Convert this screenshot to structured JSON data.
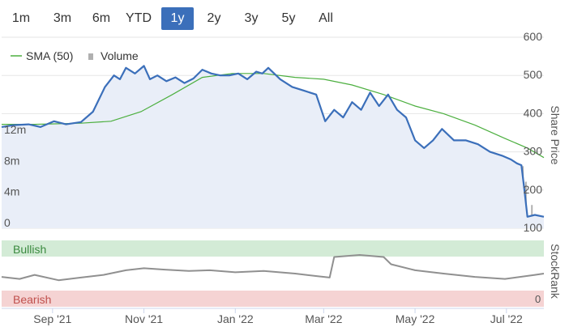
{
  "range_selector": {
    "buttons": [
      "1m",
      "3m",
      "6m",
      "YTD",
      "1y",
      "2y",
      "3y",
      "5y",
      "All"
    ],
    "active": "1y"
  },
  "colors": {
    "price": "#3b6fba",
    "sma": "#4caf3f",
    "volume": "#b0b0b0",
    "stockrank": "#909090",
    "bullish_band": "#d3ebd6",
    "bearish_band": "#f5d3d3"
  },
  "chart_data": [
    {
      "type": "line",
      "panel": "price",
      "legend": [
        "SMA (50)",
        "Volume"
      ],
      "y_axis": {
        "title": "Share Price",
        "ticks": [
          100,
          200,
          300,
          400,
          500,
          600
        ],
        "range": [
          100,
          600
        ]
      },
      "volume_axis": {
        "ticks": [
          "0",
          "4m",
          "8m",
          "12m"
        ],
        "range_millions": [
          0,
          12
        ]
      },
      "x_axis": {
        "ticks": [
          "Sep '21",
          "Nov '21",
          "Jan '22",
          "Mar '22",
          "May '22",
          "Jul '22"
        ]
      },
      "series": [
        {
          "name": "",
          "x": [
            "2021-07-29",
            "2021-08-06",
            "2021-08-16",
            "2021-08-24",
            "2021-09-02",
            "2021-09-10",
            "2021-09-20",
            "2021-09-28",
            "2021-10-06",
            "2021-10-12",
            "2021-10-16",
            "2021-10-20",
            "2021-10-26",
            "2021-11-01",
            "2021-11-05",
            "2021-11-10",
            "2021-11-16",
            "2021-11-22",
            "2021-11-28",
            "2021-12-04",
            "2021-12-10",
            "2021-12-16",
            "2021-12-22",
            "2021-12-28",
            "2022-01-03",
            "2022-01-09",
            "2022-01-15",
            "2022-01-19",
            "2022-01-23",
            "2022-01-31",
            "2022-02-08",
            "2022-02-16",
            "2022-02-24",
            "2022-03-02",
            "2022-03-08",
            "2022-03-14",
            "2022-03-20",
            "2022-03-26",
            "2022-04-01",
            "2022-04-07",
            "2022-04-13",
            "2022-04-19",
            "2022-04-25",
            "2022-05-01",
            "2022-05-07",
            "2022-05-13",
            "2022-05-19",
            "2022-05-27",
            "2022-06-04",
            "2022-06-12",
            "2022-06-20",
            "2022-06-28",
            "2022-07-04",
            "2022-07-08",
            "2022-07-11",
            "2022-07-13",
            "2022-07-15",
            "2022-07-20",
            "2022-07-26"
          ],
          "values": [
            365,
            370,
            372,
            365,
            380,
            372,
            378,
            405,
            470,
            500,
            490,
            520,
            505,
            525,
            490,
            500,
            485,
            495,
            480,
            492,
            515,
            505,
            500,
            500,
            505,
            490,
            510,
            505,
            520,
            490,
            470,
            460,
            450,
            380,
            410,
            390,
            430,
            410,
            455,
            420,
            450,
            410,
            390,
            330,
            310,
            330,
            360,
            330,
            330,
            320,
            300,
            290,
            280,
            270,
            265,
            200,
            130,
            135,
            130
          ]
        },
        {
          "name": "SMA (50)",
          "x": [
            "2021-07-29",
            "2021-08-20",
            "2021-09-20",
            "2021-10-10",
            "2021-10-30",
            "2021-11-20",
            "2021-12-10",
            "2021-12-30",
            "2022-01-20",
            "2022-02-10",
            "2022-03-01",
            "2022-03-20",
            "2022-04-10",
            "2022-05-01",
            "2022-05-20",
            "2022-06-10",
            "2022-06-30",
            "2022-07-15",
            "2022-07-26"
          ],
          "values": [
            372,
            372,
            375,
            380,
            405,
            450,
            495,
            505,
            505,
            495,
            490,
            475,
            450,
            420,
            400,
            370,
            335,
            310,
            285
          ]
        },
        {
          "name": "Volume",
          "unit": "millions",
          "x": [
            "2021-08-20",
            "2021-10-18",
            "2021-11-01",
            "2021-11-25",
            "2021-12-20",
            "2022-01-10",
            "2022-02-08",
            "2022-03-05",
            "2022-04-10",
            "2022-05-15",
            "2022-06-15",
            "2022-07-02",
            "2022-07-08",
            "2022-07-12",
            "2022-07-14",
            "2022-07-18",
            "2022-07-22"
          ],
          "values": [
            0.3,
            0.6,
            0.5,
            0.4,
            0.3,
            0.5,
            0.3,
            0.6,
            0.4,
            0.7,
            0.4,
            0.5,
            2.0,
            8.0,
            6.0,
            3.0,
            0.8
          ]
        }
      ]
    },
    {
      "type": "line",
      "panel": "stockrank",
      "y_axis": {
        "title": "StockRank",
        "ticks": [
          "0"
        ],
        "range": [
          0,
          100
        ]
      },
      "bands": [
        "Bullish",
        "Bearish"
      ],
      "series": [
        {
          "name": "",
          "x": [
            "2021-07-29",
            "2021-08-10",
            "2021-08-20",
            "2021-09-05",
            "2021-09-20",
            "2021-10-05",
            "2021-10-20",
            "2021-11-01",
            "2021-11-15",
            "2021-12-01",
            "2021-12-15",
            "2022-01-01",
            "2022-01-20",
            "2022-02-10",
            "2022-02-25",
            "2022-03-05",
            "2022-03-08",
            "2022-03-25",
            "2022-04-10",
            "2022-04-15",
            "2022-05-01",
            "2022-05-20",
            "2022-06-10",
            "2022-06-30",
            "2022-07-20",
            "2022-07-26"
          ],
          "values": [
            45,
            42,
            48,
            40,
            44,
            48,
            55,
            58,
            56,
            54,
            55,
            52,
            54,
            50,
            46,
            44,
            75,
            78,
            75,
            64,
            55,
            50,
            45,
            42,
            48,
            50
          ]
        }
      ]
    }
  ]
}
